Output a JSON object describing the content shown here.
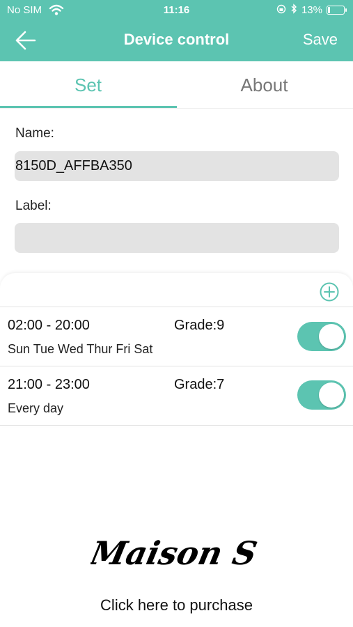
{
  "status_bar": {
    "carrier": "No SIM",
    "time": "11:16",
    "battery": "13%",
    "battery_level": 0.13
  },
  "navbar": {
    "title": "Device control",
    "save_label": "Save",
    "back_icon": "arrow-left-icon"
  },
  "tabs": [
    {
      "label": "Set",
      "active": true
    },
    {
      "label": "About",
      "active": false
    }
  ],
  "form": {
    "name_label": "Name:",
    "name_value": "8150D_AFFBA350",
    "label_label": "Label:",
    "label_value": ""
  },
  "schedules": [
    {
      "time": "02:00 - 20:00",
      "grade": "Grade:9",
      "days": "Sun Tue Wed Thur Fri Sat",
      "enabled": true
    },
    {
      "time": "21:00 - 23:00",
      "grade": "Grade:7",
      "days": "Every day",
      "enabled": true
    }
  ],
  "footer": {
    "logo_text": "Maison S",
    "purchase_label": "Click here to purchase"
  },
  "colors": {
    "accent": "#5cc4b1",
    "field_bg": "#e3e3e3"
  }
}
